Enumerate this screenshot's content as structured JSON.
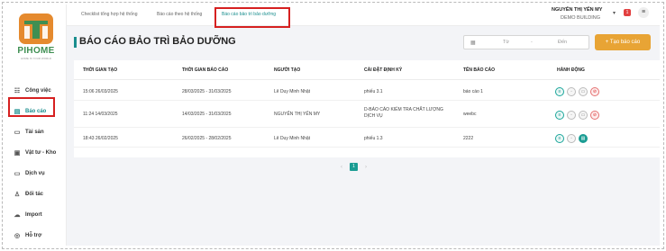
{
  "colors": {
    "accent": "#1a9c93",
    "highlight": "#d62020",
    "create_button": "#e8a435",
    "delete": "#e24040"
  },
  "logo": {
    "text": "PIHOME",
    "tagline": "HOME IS YOUR WORLD"
  },
  "sidebar": {
    "items": [
      {
        "label": "Công việc",
        "icon": "task-icon"
      },
      {
        "label": "Báo cáo",
        "icon": "report-icon",
        "active": true
      },
      {
        "label": "Tài sản",
        "icon": "asset-icon"
      },
      {
        "label": "Vật tư - Kho",
        "icon": "warehouse-icon"
      },
      {
        "label": "Dịch vụ",
        "icon": "service-icon"
      },
      {
        "label": "Đối tác",
        "icon": "partner-icon"
      },
      {
        "label": "Import",
        "icon": "import-icon"
      },
      {
        "label": "Hỗ trợ",
        "icon": "support-icon"
      }
    ]
  },
  "tabs": [
    {
      "label": "Checklist tổng hợp hệ thống"
    },
    {
      "label": "Báo cáo theo hệ thống"
    },
    {
      "label": "Báo cáo bảo trì bảo dưỡng",
      "active": true
    }
  ],
  "user": {
    "name": "NGUYỄN THỊ YẾN MY",
    "building": "DEMO BUILDING",
    "notification_count": "1"
  },
  "page": {
    "title": "BÁO CÁO BẢO TRÌ BẢO DƯỠNG"
  },
  "filter": {
    "from_placeholder": "Từ",
    "separator": "-",
    "to_placeholder": "Đến"
  },
  "create_button": "+ Tạo báo cáo",
  "table": {
    "columns": [
      "THỜI GIAN TẠO",
      "THỜI GIAN BÁO CÁO",
      "NGƯỜI TẠO",
      "CÀI ĐẶT ĐỊNH KỲ",
      "TÊN BÁO CÁO",
      "HÀNH ĐỘNG"
    ],
    "rows": [
      {
        "created": "15:06 26/03/2025",
        "period": "28/03/2025 - 31/03/2025",
        "creator": "Lê Duy Minh Nhật",
        "schedule": "phiếu 3.1",
        "name": "báo cáo 1",
        "actions": [
          "view",
          "comment",
          "edit",
          "delete"
        ]
      },
      {
        "created": "11:24 14/03/2025",
        "period": "14/03/2025 - 31/03/2025",
        "creator": "NGUYỄN THỊ YẾN MY",
        "schedule": "D-BÁO CÁO KIỂM TRA CHẤT LƯỢNG DỊCH VỤ",
        "name": "weebc",
        "actions": [
          "view",
          "comment",
          "edit",
          "delete"
        ]
      },
      {
        "created": "18:43 26/02/2025",
        "period": "26/02/2025 - 28/02/2025",
        "creator": "Lê Duy Minh Nhật",
        "schedule": "phiếu 1.3",
        "name": "2222",
        "actions": [
          "view",
          "comment",
          "print"
        ]
      }
    ]
  },
  "pagination": {
    "prev": "‹",
    "current": "1",
    "next": "›"
  }
}
